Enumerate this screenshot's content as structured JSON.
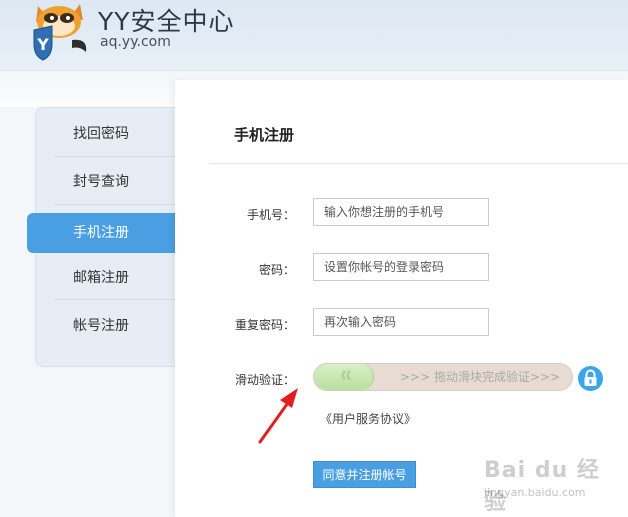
{
  "brand": {
    "title": "YY安全中心",
    "url": "aq.yy.com",
    "logo_letter": "Y"
  },
  "sidebar": {
    "items": [
      {
        "label": "找回密码",
        "active": false
      },
      {
        "label": "封号查询",
        "active": false
      },
      {
        "label": "手机注册",
        "active": true
      },
      {
        "label": "邮箱注册",
        "active": false
      },
      {
        "label": "帐号注册",
        "active": false
      }
    ]
  },
  "main": {
    "title": "手机注册",
    "form": {
      "phone": {
        "label": "手机号：",
        "placeholder": "输入你想注册的手机号",
        "value": ""
      },
      "password": {
        "label": "密码：",
        "placeholder": "设置你帐号的登录密码",
        "value": ""
      },
      "repeat_password": {
        "label": "重复密码：",
        "placeholder": "再次输入密码",
        "value": ""
      },
      "slider": {
        "label": "滑动验证：",
        "handle_glyph": "《《",
        "hint": ">>> 拖动滑块完成验证>>>",
        "progress": 0
      },
      "agreement": "《用户服务协议》",
      "submit": "同意并注册帐号"
    }
  },
  "watermark": {
    "main": "Bai du 经验",
    "sub": "jingyan.baidu.com"
  },
  "colors": {
    "accent": "#4a9fe2",
    "slider_track": "#e8dcd2",
    "slider_handle": "#b9e0a0",
    "lock": "#3aa6ea",
    "annotation": "#e02020"
  }
}
